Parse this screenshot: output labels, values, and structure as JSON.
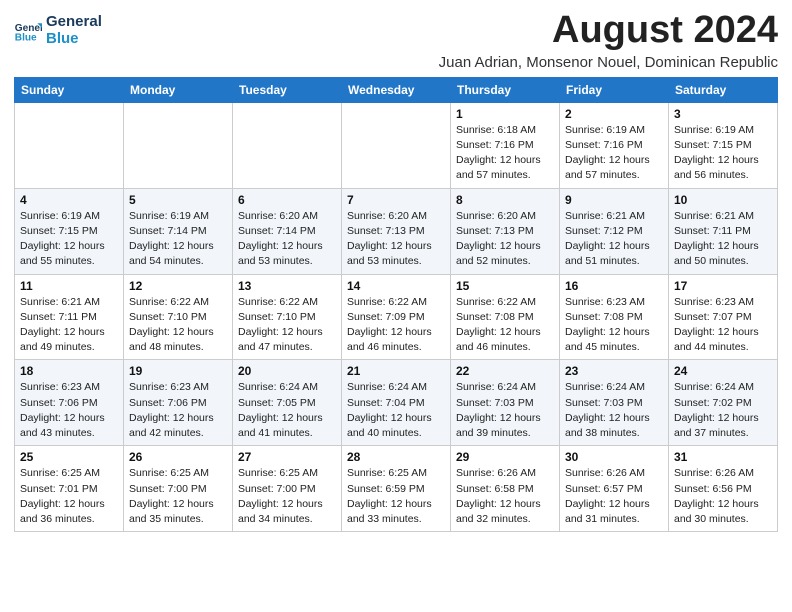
{
  "header": {
    "logo_line1": "General",
    "logo_line2": "Blue",
    "title": "August 2024",
    "subtitle": "Juan Adrian, Monsenor Nouel, Dominican Republic"
  },
  "weekdays": [
    "Sunday",
    "Monday",
    "Tuesday",
    "Wednesday",
    "Thursday",
    "Friday",
    "Saturday"
  ],
  "weeks": [
    [
      {
        "day": "",
        "info": ""
      },
      {
        "day": "",
        "info": ""
      },
      {
        "day": "",
        "info": ""
      },
      {
        "day": "",
        "info": ""
      },
      {
        "day": "1",
        "info": "Sunrise: 6:18 AM\nSunset: 7:16 PM\nDaylight: 12 hours\nand 57 minutes."
      },
      {
        "day": "2",
        "info": "Sunrise: 6:19 AM\nSunset: 7:16 PM\nDaylight: 12 hours\nand 57 minutes."
      },
      {
        "day": "3",
        "info": "Sunrise: 6:19 AM\nSunset: 7:15 PM\nDaylight: 12 hours\nand 56 minutes."
      }
    ],
    [
      {
        "day": "4",
        "info": "Sunrise: 6:19 AM\nSunset: 7:15 PM\nDaylight: 12 hours\nand 55 minutes."
      },
      {
        "day": "5",
        "info": "Sunrise: 6:19 AM\nSunset: 7:14 PM\nDaylight: 12 hours\nand 54 minutes."
      },
      {
        "day": "6",
        "info": "Sunrise: 6:20 AM\nSunset: 7:14 PM\nDaylight: 12 hours\nand 53 minutes."
      },
      {
        "day": "7",
        "info": "Sunrise: 6:20 AM\nSunset: 7:13 PM\nDaylight: 12 hours\nand 53 minutes."
      },
      {
        "day": "8",
        "info": "Sunrise: 6:20 AM\nSunset: 7:13 PM\nDaylight: 12 hours\nand 52 minutes."
      },
      {
        "day": "9",
        "info": "Sunrise: 6:21 AM\nSunset: 7:12 PM\nDaylight: 12 hours\nand 51 minutes."
      },
      {
        "day": "10",
        "info": "Sunrise: 6:21 AM\nSunset: 7:11 PM\nDaylight: 12 hours\nand 50 minutes."
      }
    ],
    [
      {
        "day": "11",
        "info": "Sunrise: 6:21 AM\nSunset: 7:11 PM\nDaylight: 12 hours\nand 49 minutes."
      },
      {
        "day": "12",
        "info": "Sunrise: 6:22 AM\nSunset: 7:10 PM\nDaylight: 12 hours\nand 48 minutes."
      },
      {
        "day": "13",
        "info": "Sunrise: 6:22 AM\nSunset: 7:10 PM\nDaylight: 12 hours\nand 47 minutes."
      },
      {
        "day": "14",
        "info": "Sunrise: 6:22 AM\nSunset: 7:09 PM\nDaylight: 12 hours\nand 46 minutes."
      },
      {
        "day": "15",
        "info": "Sunrise: 6:22 AM\nSunset: 7:08 PM\nDaylight: 12 hours\nand 46 minutes."
      },
      {
        "day": "16",
        "info": "Sunrise: 6:23 AM\nSunset: 7:08 PM\nDaylight: 12 hours\nand 45 minutes."
      },
      {
        "day": "17",
        "info": "Sunrise: 6:23 AM\nSunset: 7:07 PM\nDaylight: 12 hours\nand 44 minutes."
      }
    ],
    [
      {
        "day": "18",
        "info": "Sunrise: 6:23 AM\nSunset: 7:06 PM\nDaylight: 12 hours\nand 43 minutes."
      },
      {
        "day": "19",
        "info": "Sunrise: 6:23 AM\nSunset: 7:06 PM\nDaylight: 12 hours\nand 42 minutes."
      },
      {
        "day": "20",
        "info": "Sunrise: 6:24 AM\nSunset: 7:05 PM\nDaylight: 12 hours\nand 41 minutes."
      },
      {
        "day": "21",
        "info": "Sunrise: 6:24 AM\nSunset: 7:04 PM\nDaylight: 12 hours\nand 40 minutes."
      },
      {
        "day": "22",
        "info": "Sunrise: 6:24 AM\nSunset: 7:03 PM\nDaylight: 12 hours\nand 39 minutes."
      },
      {
        "day": "23",
        "info": "Sunrise: 6:24 AM\nSunset: 7:03 PM\nDaylight: 12 hours\nand 38 minutes."
      },
      {
        "day": "24",
        "info": "Sunrise: 6:24 AM\nSunset: 7:02 PM\nDaylight: 12 hours\nand 37 minutes."
      }
    ],
    [
      {
        "day": "25",
        "info": "Sunrise: 6:25 AM\nSunset: 7:01 PM\nDaylight: 12 hours\nand 36 minutes."
      },
      {
        "day": "26",
        "info": "Sunrise: 6:25 AM\nSunset: 7:00 PM\nDaylight: 12 hours\nand 35 minutes."
      },
      {
        "day": "27",
        "info": "Sunrise: 6:25 AM\nSunset: 7:00 PM\nDaylight: 12 hours\nand 34 minutes."
      },
      {
        "day": "28",
        "info": "Sunrise: 6:25 AM\nSunset: 6:59 PM\nDaylight: 12 hours\nand 33 minutes."
      },
      {
        "day": "29",
        "info": "Sunrise: 6:26 AM\nSunset: 6:58 PM\nDaylight: 12 hours\nand 32 minutes."
      },
      {
        "day": "30",
        "info": "Sunrise: 6:26 AM\nSunset: 6:57 PM\nDaylight: 12 hours\nand 31 minutes."
      },
      {
        "day": "31",
        "info": "Sunrise: 6:26 AM\nSunset: 6:56 PM\nDaylight: 12 hours\nand 30 minutes."
      }
    ]
  ]
}
